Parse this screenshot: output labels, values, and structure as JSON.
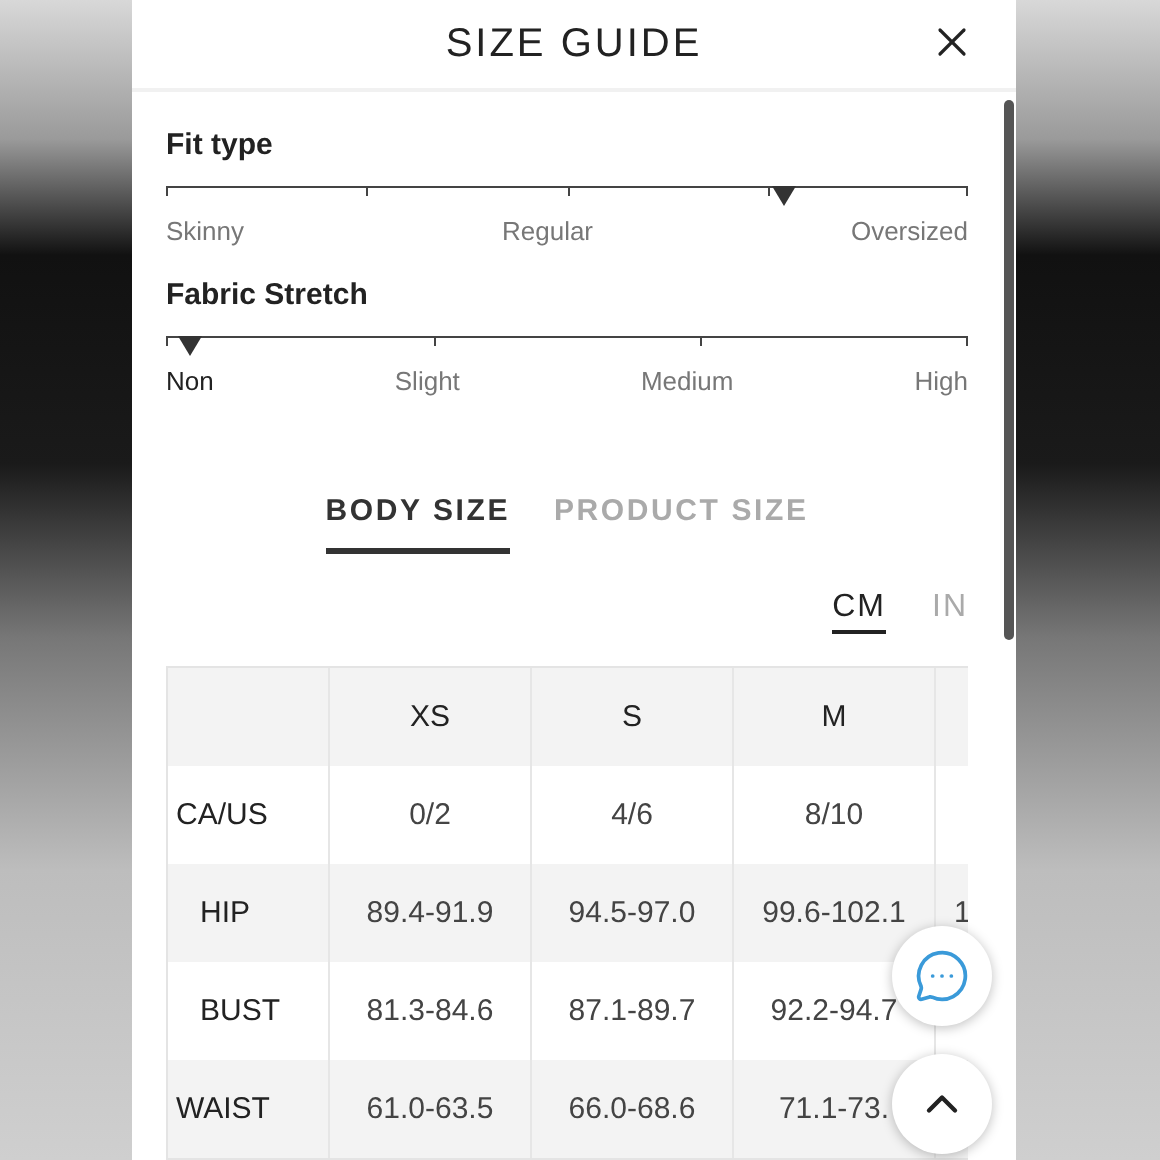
{
  "title": "SIZE GUIDE",
  "scales": [
    {
      "kind": "fit",
      "label": "Fit type",
      "level": 0.77,
      "stops": [
        {
          "label": "Skinny",
          "selected": false
        },
        {
          "label": "Regular",
          "selected": false
        },
        {
          "label": "Oversized",
          "selected": false
        }
      ]
    },
    {
      "kind": "stretch",
      "label": "Fabric Stretch",
      "level": 0.015,
      "stops": [
        {
          "label": "Non",
          "selected": true
        },
        {
          "label": "Slight",
          "selected": false
        },
        {
          "label": "Medium",
          "selected": false
        },
        {
          "label": "High",
          "selected": false
        }
      ]
    }
  ],
  "tabs": [
    {
      "label": "BODY SIZE",
      "selected": true
    },
    {
      "label": "PRODUCT SIZE",
      "selected": false
    }
  ],
  "units": [
    {
      "label": "CM",
      "selected": true
    },
    {
      "label": "IN",
      "selected": false
    }
  ],
  "table": {
    "columns": [
      "XS",
      "S",
      "M"
    ],
    "rows": [
      {
        "label": "CA/US",
        "cells": [
          "0/2",
          "4/6",
          "8/10"
        ]
      },
      {
        "label": "HIP",
        "cells": [
          "89.4-91.9",
          "94.5-97.0",
          "99.6-102.1",
          "1"
        ]
      },
      {
        "label": "BUST",
        "cells": [
          "81.3-84.6",
          "87.1-89.7",
          "92.2-94.7"
        ]
      },
      {
        "label": "WAIST",
        "cells": [
          "61.0-63.5",
          "66.0-68.6",
          "71.1-73."
        ]
      }
    ]
  }
}
